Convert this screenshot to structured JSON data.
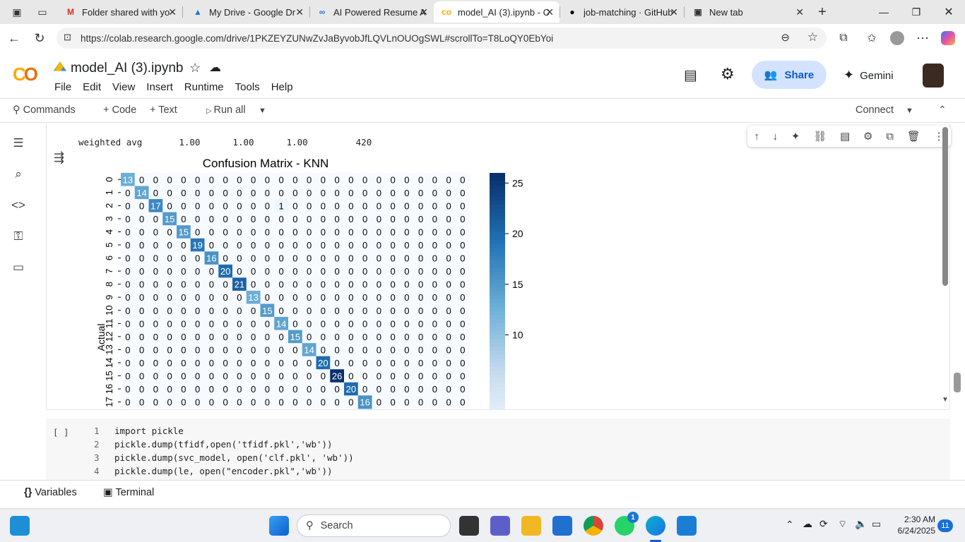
{
  "browser": {
    "tabs": [
      {
        "title": "Folder shared with yo",
        "icon": "gmail-icon",
        "color": "#d93025"
      },
      {
        "title": "My Drive - Google Dr",
        "icon": "drive-icon",
        "color": "#1a73e8"
      },
      {
        "title": "AI Powered Resume A",
        "icon": "colab-small-icon",
        "color": "#1a73e8"
      },
      {
        "title": "model_AI (3).ipynb - C",
        "icon": "colab-icon",
        "color": "#f9ab00"
      },
      {
        "title": "job-matching · GitHub",
        "icon": "github-icon",
        "color": "#000000"
      },
      {
        "title": "New tab",
        "icon": "newtab-icon",
        "color": "#333333"
      }
    ],
    "url": "https://colab.research.google.com/drive/1PKZEYZUNwZvJaByvobJfLQVLnOUOgSWL#scrollTo=T8LoQY0EbYoi"
  },
  "colab": {
    "title": "model_AI (3).ipynb",
    "menu": [
      "File",
      "Edit",
      "View",
      "Insert",
      "Runtime",
      "Tools",
      "Help"
    ],
    "share": "Share",
    "gemini": "Gemini",
    "toolbar": {
      "commands": "Commands",
      "code": "+ Code",
      "text": "+ Text",
      "run_all": "Run all",
      "connect": "Connect"
    }
  },
  "output": {
    "report_line": {
      "label": "weighted avg",
      "precision": "1.00",
      "recall": "1.00",
      "f1": "1.00",
      "support": "420"
    }
  },
  "chart_data": {
    "type": "heatmap",
    "title": "Confusion Matrix - KNN",
    "ylabel": "Actual",
    "row_labels": [
      "0",
      "1",
      "2",
      "3",
      "4",
      "5",
      "6",
      "7",
      "8",
      "9",
      "10",
      "11",
      "12",
      "13",
      "14",
      "15",
      "16",
      "17"
    ],
    "n_cols": 25,
    "rows": [
      [
        13,
        0,
        0,
        0,
        0,
        0,
        0,
        0,
        0,
        0,
        0,
        0,
        0,
        0,
        0,
        0,
        0,
        0,
        0,
        0,
        0,
        0,
        0,
        0,
        0
      ],
      [
        0,
        14,
        0,
        0,
        0,
        0,
        0,
        0,
        0,
        0,
        0,
        0,
        0,
        0,
        0,
        0,
        0,
        0,
        0,
        0,
        0,
        0,
        0,
        0,
        0
      ],
      [
        0,
        0,
        17,
        0,
        0,
        0,
        0,
        0,
        0,
        0,
        0,
        1,
        0,
        0,
        0,
        0,
        0,
        0,
        0,
        0,
        0,
        0,
        0,
        0,
        0
      ],
      [
        0,
        0,
        0,
        15,
        0,
        0,
        0,
        0,
        0,
        0,
        0,
        0,
        0,
        0,
        0,
        0,
        0,
        0,
        0,
        0,
        0,
        0,
        0,
        0,
        0
      ],
      [
        0,
        0,
        0,
        0,
        15,
        0,
        0,
        0,
        0,
        0,
        0,
        0,
        0,
        0,
        0,
        0,
        0,
        0,
        0,
        0,
        0,
        0,
        0,
        0,
        0
      ],
      [
        0,
        0,
        0,
        0,
        0,
        19,
        0,
        0,
        0,
        0,
        0,
        0,
        0,
        0,
        0,
        0,
        0,
        0,
        0,
        0,
        0,
        0,
        0,
        0,
        0
      ],
      [
        0,
        0,
        0,
        0,
        0,
        0,
        16,
        0,
        0,
        0,
        0,
        0,
        0,
        0,
        0,
        0,
        0,
        0,
        0,
        0,
        0,
        0,
        0,
        0,
        0
      ],
      [
        0,
        0,
        0,
        0,
        0,
        0,
        0,
        20,
        0,
        0,
        0,
        0,
        0,
        0,
        0,
        0,
        0,
        0,
        0,
        0,
        0,
        0,
        0,
        0,
        0
      ],
      [
        0,
        0,
        0,
        0,
        0,
        0,
        0,
        0,
        21,
        0,
        0,
        0,
        0,
        0,
        0,
        0,
        0,
        0,
        0,
        0,
        0,
        0,
        0,
        0,
        0
      ],
      [
        0,
        0,
        0,
        0,
        0,
        0,
        0,
        0,
        0,
        13,
        0,
        0,
        0,
        0,
        0,
        0,
        0,
        0,
        0,
        0,
        0,
        0,
        0,
        0,
        0
      ],
      [
        0,
        0,
        0,
        0,
        0,
        0,
        0,
        0,
        0,
        0,
        15,
        0,
        0,
        0,
        0,
        0,
        0,
        0,
        0,
        0,
        0,
        0,
        0,
        0,
        0
      ],
      [
        0,
        0,
        0,
        0,
        0,
        0,
        0,
        0,
        0,
        0,
        0,
        14,
        0,
        0,
        0,
        0,
        0,
        0,
        0,
        0,
        0,
        0,
        0,
        0,
        0
      ],
      [
        0,
        0,
        0,
        0,
        0,
        0,
        0,
        0,
        0,
        0,
        0,
        0,
        15,
        0,
        0,
        0,
        0,
        0,
        0,
        0,
        0,
        0,
        0,
        0,
        0
      ],
      [
        0,
        0,
        0,
        0,
        0,
        0,
        0,
        0,
        0,
        0,
        0,
        0,
        0,
        14,
        0,
        0,
        0,
        0,
        0,
        0,
        0,
        0,
        0,
        0,
        0
      ],
      [
        0,
        0,
        0,
        0,
        0,
        0,
        0,
        0,
        0,
        0,
        0,
        0,
        0,
        0,
        20,
        0,
        0,
        0,
        0,
        0,
        0,
        0,
        0,
        0,
        0
      ],
      [
        0,
        0,
        0,
        0,
        0,
        0,
        0,
        0,
        0,
        0,
        0,
        0,
        0,
        0,
        0,
        26,
        0,
        0,
        0,
        0,
        0,
        0,
        0,
        0,
        0
      ],
      [
        0,
        0,
        0,
        0,
        0,
        0,
        0,
        0,
        0,
        0,
        0,
        0,
        0,
        0,
        0,
        0,
        20,
        0,
        0,
        0,
        0,
        0,
        0,
        0,
        0
      ],
      [
        0,
        0,
        0,
        0,
        0,
        0,
        0,
        0,
        0,
        0,
        0,
        0,
        0,
        0,
        0,
        0,
        0,
        16,
        0,
        0,
        0,
        0,
        0,
        0,
        0
      ]
    ],
    "colorbar_ticks": [
      25,
      20,
      15,
      10
    ],
    "vmin": 0,
    "vmax": 26
  },
  "code_cell": {
    "run_label": "[ ]",
    "lines": [
      {
        "n": "1",
        "text": "import pickle"
      },
      {
        "n": "2",
        "text": "pickle.dump(tfidf,open('tfidf.pkl','wb'))"
      },
      {
        "n": "3",
        "text": "pickle.dump(svc_model, open('clf.pkl', 'wb'))"
      },
      {
        "n": "4",
        "text": "pickle.dump(le, open(\"encoder.pkl\",'wb'))"
      }
    ]
  },
  "bottom": {
    "variables": "Variables",
    "terminal": "Terminal"
  },
  "taskbar": {
    "search": "Search",
    "time": "2:30 AM",
    "date": "6/24/2025",
    "notif_count": "11",
    "whatsapp_badge": "1"
  }
}
